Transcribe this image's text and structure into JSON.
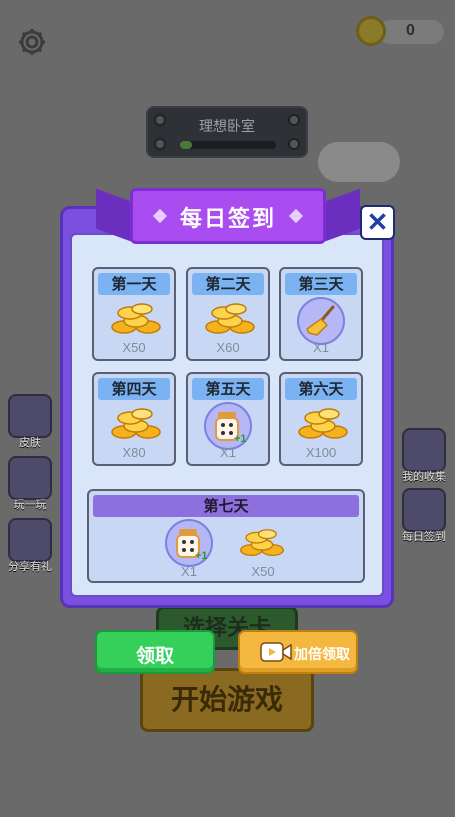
{
  "top_bar": {
    "coins": "0"
  },
  "room": {
    "title": "理想卧室",
    "progress": 0.12
  },
  "side_left": [
    {
      "label": "皮肤",
      "icon": "shirt-icon"
    },
    {
      "label": "玩一玩",
      "icon": "gamepad-icon"
    },
    {
      "label": "分享有礼",
      "icon": "gift-box-icon"
    }
  ],
  "side_right": [
    {
      "label": "我的收集",
      "icon": "book-icon"
    },
    {
      "label": "每日签到",
      "icon": "calendar-check-icon"
    }
  ],
  "bottom": {
    "select_level": "选择关卡",
    "start_game": "开始游戏"
  },
  "popup": {
    "title": "每日签到",
    "days": [
      {
        "label": "第一天",
        "reward": "coins-icon",
        "qty": "X50"
      },
      {
        "label": "第二天",
        "reward": "coins-icon",
        "qty": "X60"
      },
      {
        "label": "第三天",
        "reward": "broom-icon",
        "qty": "X1"
      },
      {
        "label": "第四天",
        "reward": "coins-icon",
        "qty": "X80"
      },
      {
        "label": "第五天",
        "reward": "dice-plus-icon",
        "qty": "X1",
        "badge": "+1"
      },
      {
        "label": "第六天",
        "reward": "coins-icon",
        "qty": "X100"
      }
    ],
    "day7": {
      "label": "第七天",
      "rewards": [
        {
          "reward": "dice-plus-icon",
          "qty": "X1",
          "badge": "+1"
        },
        {
          "reward": "coins-icon",
          "qty": "X50"
        }
      ]
    },
    "claim_label": "领取",
    "double_label": "加倍领取"
  },
  "colors": {
    "accent_purple": "#7b4fe0",
    "claim_green": "#35d05a",
    "double_orange": "#f4b840",
    "day_header_blue": "#7ab2f2"
  }
}
